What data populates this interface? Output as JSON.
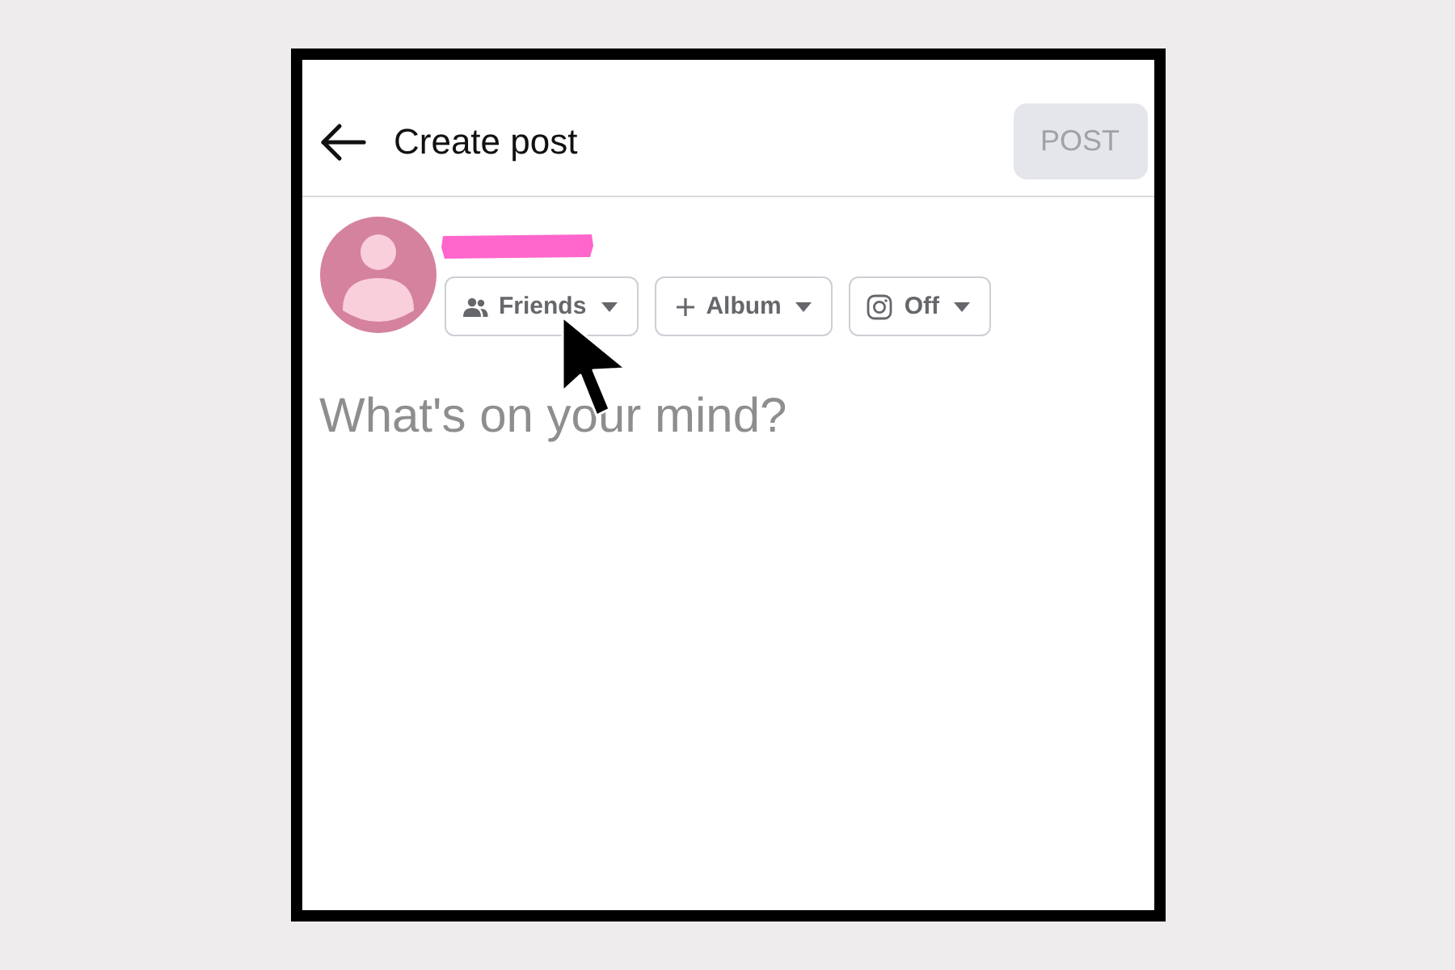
{
  "header": {
    "title": "Create post",
    "post_button": {
      "label": "POST",
      "disabled": true
    }
  },
  "chips": [
    {
      "kind": "audience",
      "label": "Friends"
    },
    {
      "kind": "album",
      "label": "Album"
    },
    {
      "kind": "camera",
      "label": "Off"
    }
  ],
  "composer": {
    "placeholder": "What's on your mind?"
  }
}
